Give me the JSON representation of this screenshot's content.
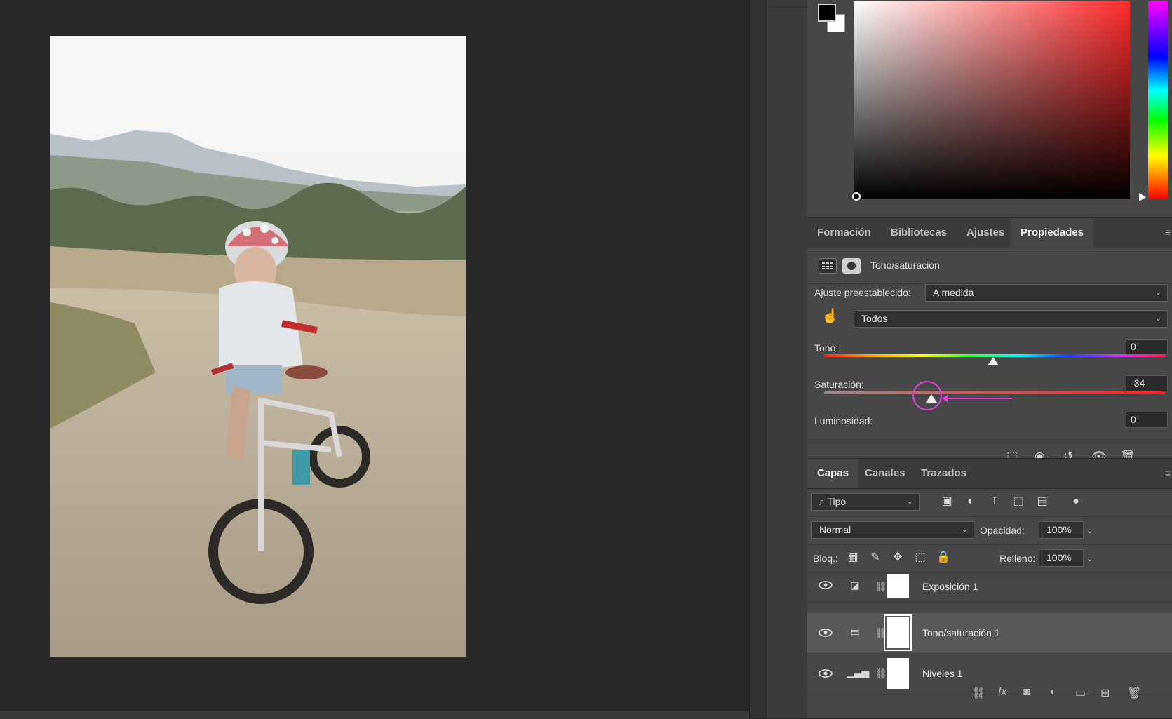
{
  "properties_panel": {
    "tabs": [
      {
        "label": "Formación",
        "active": false
      },
      {
        "label": "Bibliotecas",
        "active": false
      },
      {
        "label": "Ajustes",
        "active": false
      },
      {
        "label": "Propiedades",
        "active": true
      }
    ],
    "adjustment_title": "Tono/saturación",
    "preset_label": "Ajuste preestablecido:",
    "preset_value": "A medida",
    "channel_value": "Todos",
    "hue": {
      "label": "Tono:",
      "value": "0"
    },
    "saturation": {
      "label": "Saturación:",
      "value": "-34"
    },
    "lightness": {
      "label": "Luminosidad:",
      "value": "0"
    },
    "highlight_color": "#e040e0"
  },
  "layers_panel": {
    "tabs": [
      {
        "label": "Capas",
        "active": true
      },
      {
        "label": "Canales",
        "active": false
      },
      {
        "label": "Trazados",
        "active": false
      }
    ],
    "filter_value": "Tipo",
    "blend_mode": "Normal",
    "opacity_label": "Opacidad:",
    "opacity_value": "100%",
    "lock_label": "Bloq.:",
    "fill_label": "Relleno:",
    "fill_value": "100%",
    "layers": [
      {
        "name": "Exposición 1",
        "icon": "exposure-icon",
        "selected": false
      },
      {
        "name": "Tono/saturación 1",
        "icon": "hue-saturation-icon",
        "selected": true
      },
      {
        "name": "Niveles 1",
        "icon": "levels-icon",
        "selected": false
      }
    ]
  },
  "colors": {
    "foreground": "#000000",
    "background": "#ffffff",
    "picker_hue": "#ff2b2b"
  },
  "bottom_icons": {
    "fx": "fx"
  }
}
